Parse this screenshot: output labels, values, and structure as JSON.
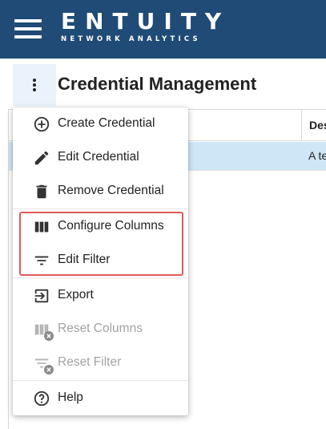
{
  "app": {
    "logo_title": "ENTUITY",
    "logo_subtitle": "NETWORK ANALYTICS",
    "brand_color": "#1f4b76"
  },
  "page": {
    "title": "Credential Management"
  },
  "table": {
    "columns": [
      {
        "label": "Des"
      }
    ],
    "rows": [
      {
        "selected": true,
        "description": "A te"
      }
    ],
    "selected_row_color": "#cfe6f7"
  },
  "menu": {
    "items": [
      {
        "label": "Create Credential",
        "icon": "add-circle-icon",
        "enabled": true
      },
      {
        "label": "Edit Credential",
        "icon": "pencil-icon",
        "enabled": true
      },
      {
        "label": "Remove Credential",
        "icon": "trash-icon",
        "enabled": true
      },
      {
        "label": "Configure Columns",
        "icon": "columns-icon",
        "enabled": true,
        "highlighted": true
      },
      {
        "label": "Edit Filter",
        "icon": "filter-icon",
        "enabled": true,
        "highlighted": true
      },
      {
        "label": "Export",
        "icon": "export-icon",
        "enabled": true
      },
      {
        "label": "Reset Columns",
        "icon": "reset-columns-icon",
        "enabled": false
      },
      {
        "label": "Reset Filter",
        "icon": "reset-filter-icon",
        "enabled": false
      },
      {
        "label": "Help",
        "icon": "help-icon",
        "enabled": true
      }
    ],
    "highlight_color": "#e05a5a"
  }
}
